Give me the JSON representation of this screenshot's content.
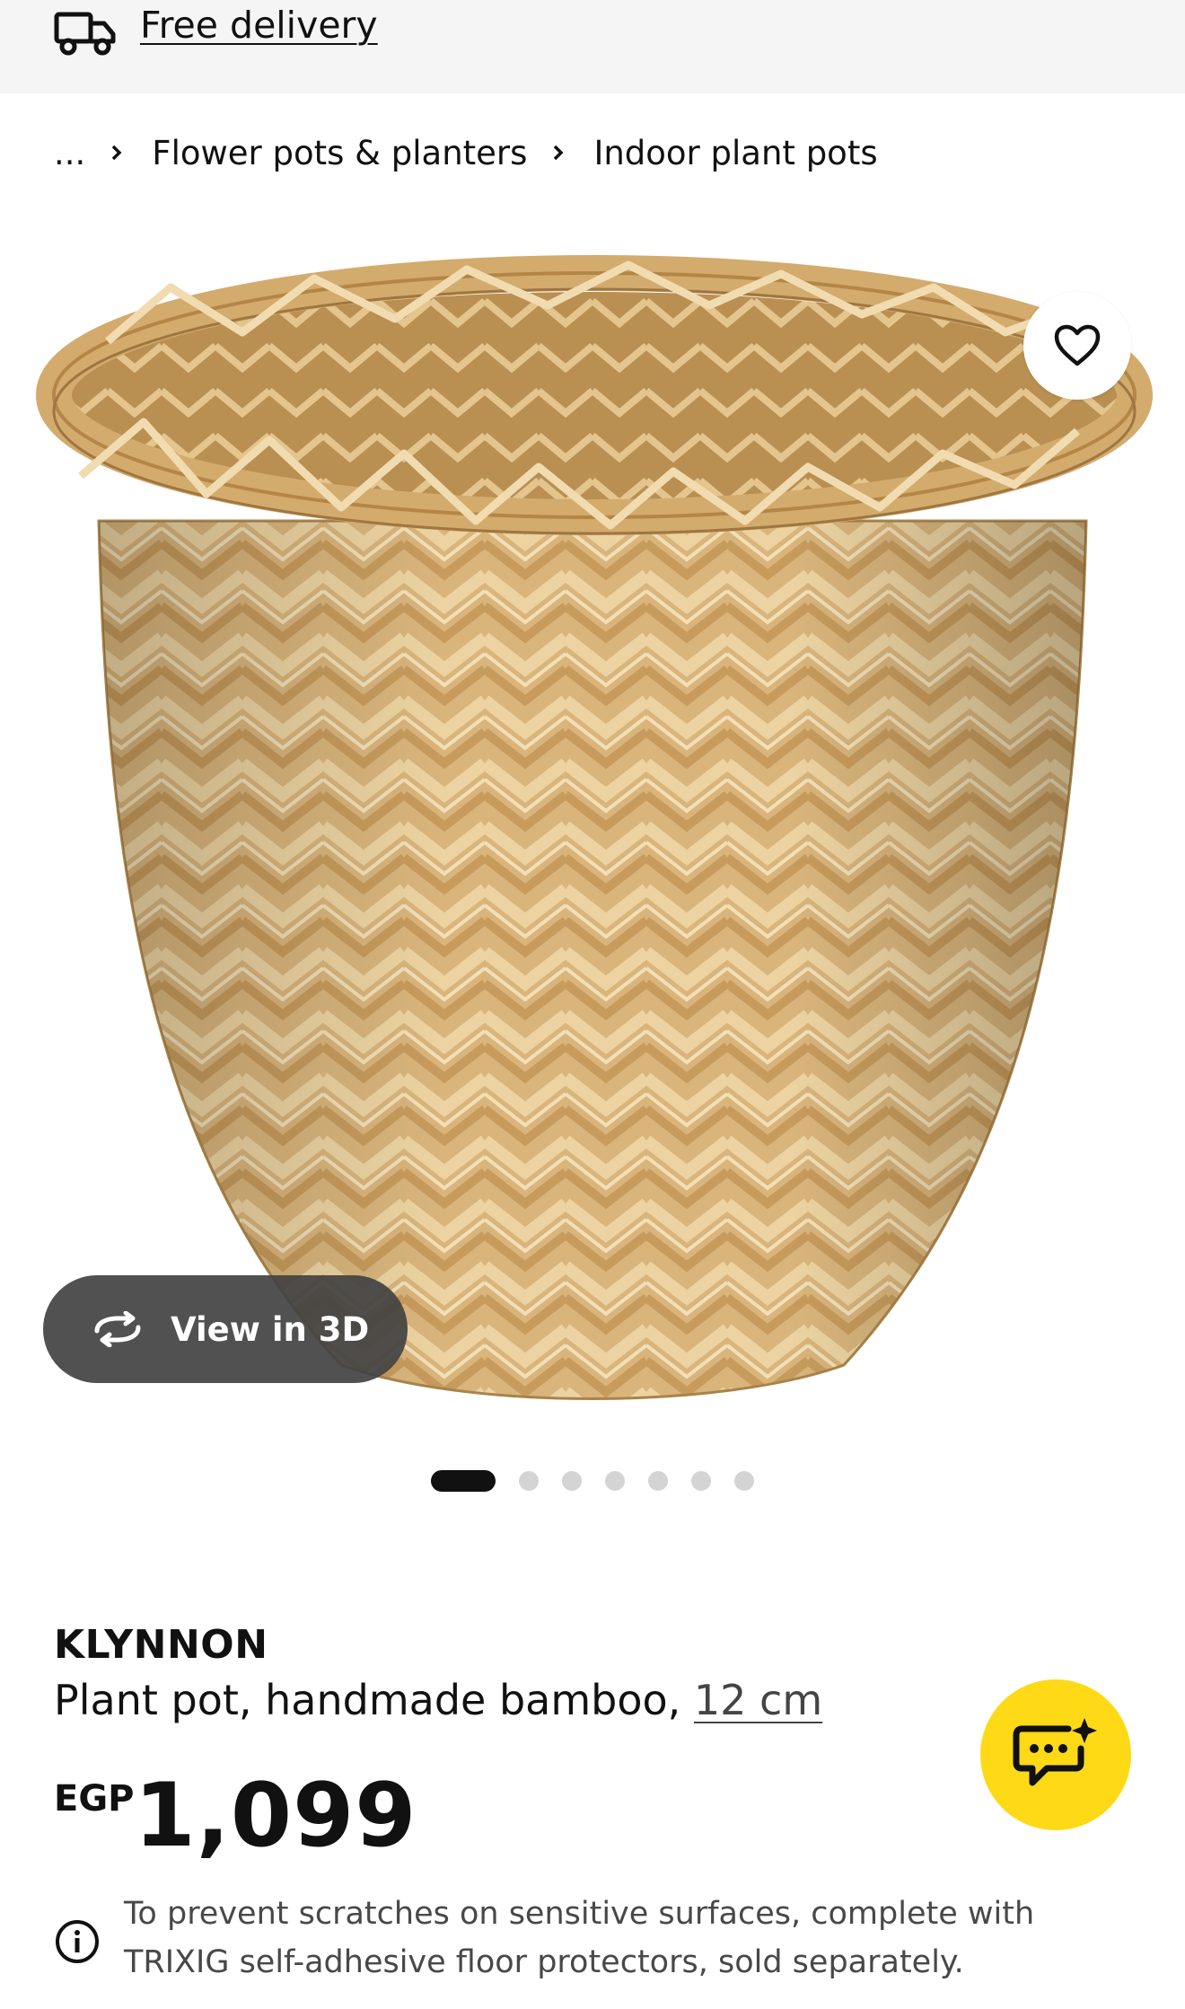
{
  "delivery": {
    "label": "Free delivery",
    "icon": "truck-icon"
  },
  "breadcrumb": {
    "items": [
      "...",
      "Flower pots & planters",
      "Indoor plant pots"
    ]
  },
  "gallery": {
    "view3d_label": "View in 3D",
    "image_count": 7,
    "active_index": 1
  },
  "product": {
    "brand": "KLYNNON",
    "description": "Plant pot, handmade bamboo,",
    "size": "12 cm",
    "currency": "EGP",
    "price": "1,099",
    "note": "To prevent scratches on sensitive surfaces, complete with TRIXIG self-adhesive floor protectors, sold separately."
  },
  "colors": {
    "topbar_bg": "#f5f5f5",
    "chat_accent": "#fed916",
    "text": "#111111"
  }
}
